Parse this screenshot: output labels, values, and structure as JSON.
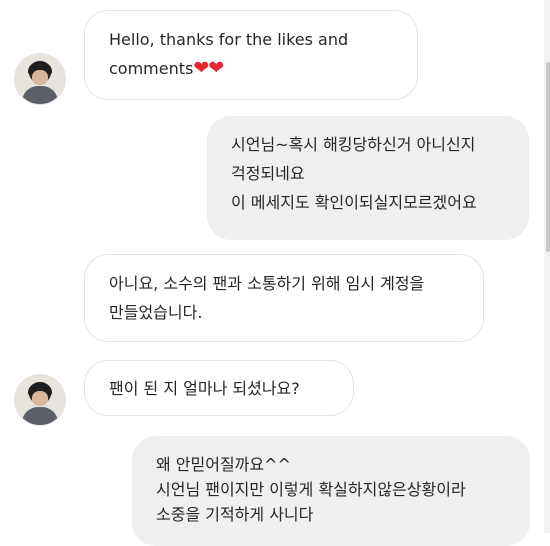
{
  "messages": [
    {
      "sender": "other",
      "lines": [
        "Hello, thanks for the likes and",
        "comments"
      ],
      "emoji": "❤❤"
    },
    {
      "sender": "me",
      "lines": [
        "시언님~혹시 해킹당하신거 아니신지",
        "걱정되네요",
        "이 메세지도 확인이되실지모르겠어요"
      ]
    },
    {
      "sender": "other",
      "lines": [
        "아니요, 소수의 팬과 소통하기 위해 임시 계정을",
        "만들었습니다."
      ]
    },
    {
      "sender": "other",
      "lines": [
        "팬이 된 지 얼마나 되셨나요?"
      ]
    },
    {
      "sender": "me",
      "lines": [
        "왜 안믿어질까요^^",
        "시언님 팬이지만 이렇게 확실하지않은상황이라",
        "소중을 기적하게 사니다"
      ]
    }
  ]
}
